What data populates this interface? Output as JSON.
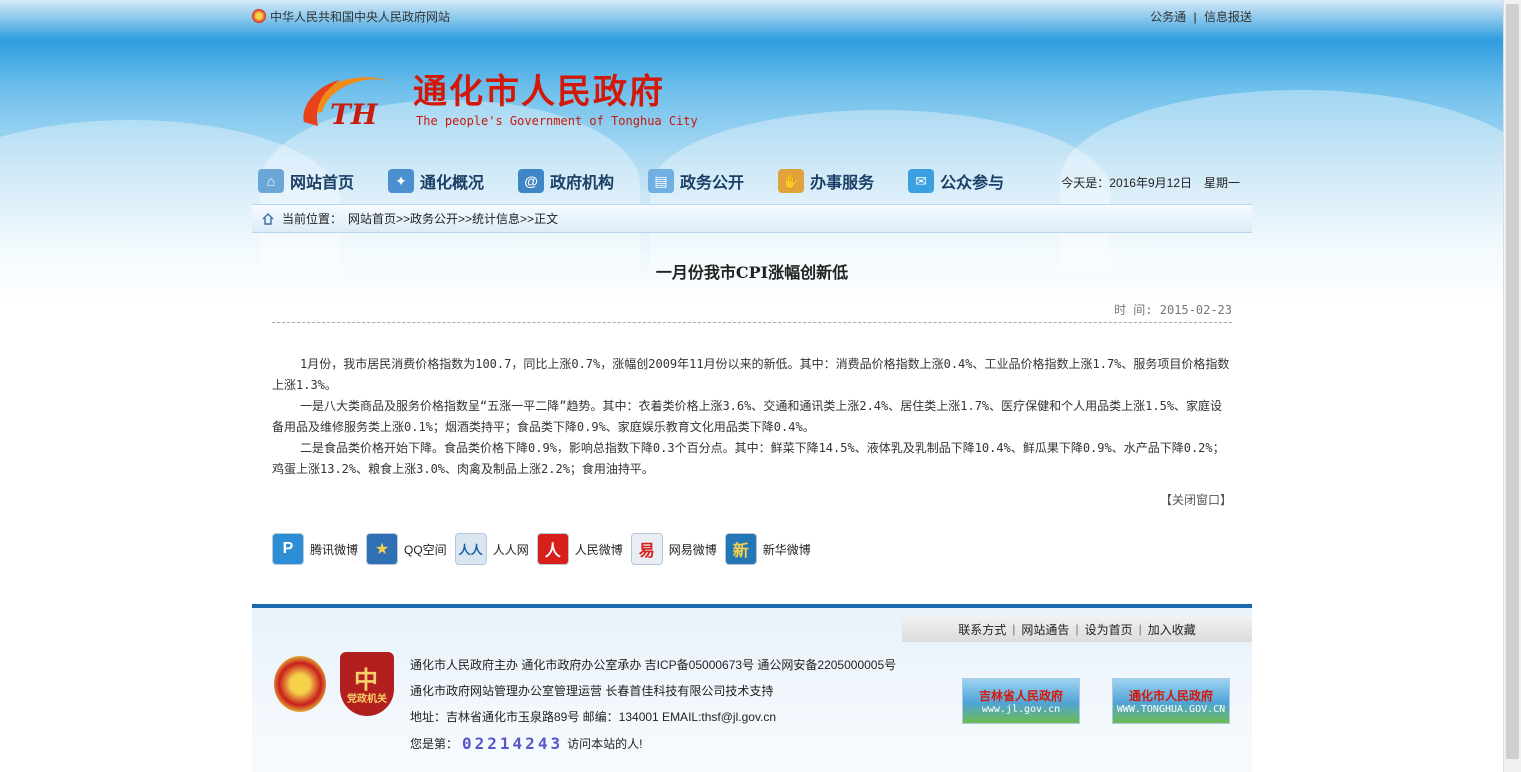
{
  "topbar": {
    "left_link": "中华人民共和国中央人民政府网站",
    "right_links": [
      "公务通",
      "信息报送"
    ],
    "separator": "|"
  },
  "logo": {
    "name_cn": "通化市人民政府",
    "name_en": "The people's Government of Tonghua City",
    "mark_text": "TH"
  },
  "nav": {
    "items": [
      {
        "label": "网站首页",
        "icon": "home-icon",
        "color": "#6aa7d8"
      },
      {
        "label": "通化概况",
        "icon": "map-icon",
        "color": "#4b8fd1"
      },
      {
        "label": "政府机构",
        "icon": "at-icon",
        "color": "#3f86c6"
      },
      {
        "label": "政务公开",
        "icon": "document-icon",
        "color": "#6fb0e0"
      },
      {
        "label": "办事服务",
        "icon": "handshake-icon",
        "color": "#e1a23b"
      },
      {
        "label": "公众参与",
        "icon": "chat-icon",
        "color": "#3aa0e0"
      }
    ],
    "date": "今天是：2016年9月12日　星期一"
  },
  "breadcrumb": {
    "prefix": "当前位置：",
    "path": "网站首页>>政务公开>>统计信息>>正文"
  },
  "article": {
    "title": "一月份我市CPI涨幅创新低",
    "meta": "时 间: 2015-02-23",
    "paragraphs": [
      "1月份，我市居民消费价格指数为100.7，同比上涨0.7%，涨幅创2009年11月份以来的新低。其中：消费品价格指数上涨0.4%、工业品价格指数上涨1.7%、服务项目价格指数上涨1.3%。",
      "一是八大类商品及服务价格指数呈“五涨一平二降”趋势。其中：衣着类价格上涨3.6%、交通和通讯类上涨2.4%、居住类上涨1.7%、医疗保健和个人用品类上涨1.5%、家庭设备用品及维修服务类上涨0.1%；烟酒类持平；食品类下降0.9%、家庭娱乐教育文化用品类下降0.4%。",
      "二是食品类价格开始下降。食品类价格下降0.9%，影响总指数下降0.3个百分点。其中：鲜菜下降14.5%、液体乳及乳制品下降10.4%、鲜瓜果下降0.9%、水产品下降0.2%；鸡蛋上涨13.2%、粮食上涨3.0%、肉禽及制品上涨2.2%；食用油持平。"
    ],
    "close_label": "【关闭窗口】"
  },
  "share": [
    {
      "label": "腾讯微博",
      "icon": "tencent-weibo-icon",
      "color": "#2d8ed6",
      "glyph": "P"
    },
    {
      "label": "QQ空间",
      "icon": "qzone-icon",
      "color": "#2f6fb3",
      "glyph": "★"
    },
    {
      "label": "人人网",
      "icon": "renren-icon",
      "color": "#d9e6f2",
      "glyph": "人人"
    },
    {
      "label": "人民微博",
      "icon": "people-weibo-icon",
      "color": "#d8201b",
      "glyph": "人"
    },
    {
      "label": "网易微博",
      "icon": "netease-weibo-icon",
      "color": "#e8eef4",
      "glyph": "易"
    },
    {
      "label": "新华微博",
      "icon": "xinhua-weibo-icon",
      "color": "#2477b7",
      "glyph": "新"
    }
  ],
  "footer": {
    "links": [
      "联系方式",
      "网站通告",
      "设为首页",
      "加入收藏"
    ],
    "lines": [
      "通化市人民政府主办 通化市政府办公室承办 吉ICP备05000673号 通公网安备2205000005号",
      "通化市政府网站管理办公室管理运营 长春首佳科技有限公司技术支持",
      "地址：吉林省通化市玉泉路89号 邮编：134001 EMAIL:thsf@jl.gov.cn"
    ],
    "counter_prefix": "您是第：",
    "counter_value": "02214243",
    "counter_suffix": "访问本站的人!",
    "badge2_big": "中",
    "badge2_label": "党政机关",
    "banners": [
      {
        "title": "吉林省人民政府",
        "url": "www.jl.gov.cn"
      },
      {
        "title": "通化市人民政府",
        "url": "WWW.TONGHUA.GOV.CN"
      }
    ]
  }
}
